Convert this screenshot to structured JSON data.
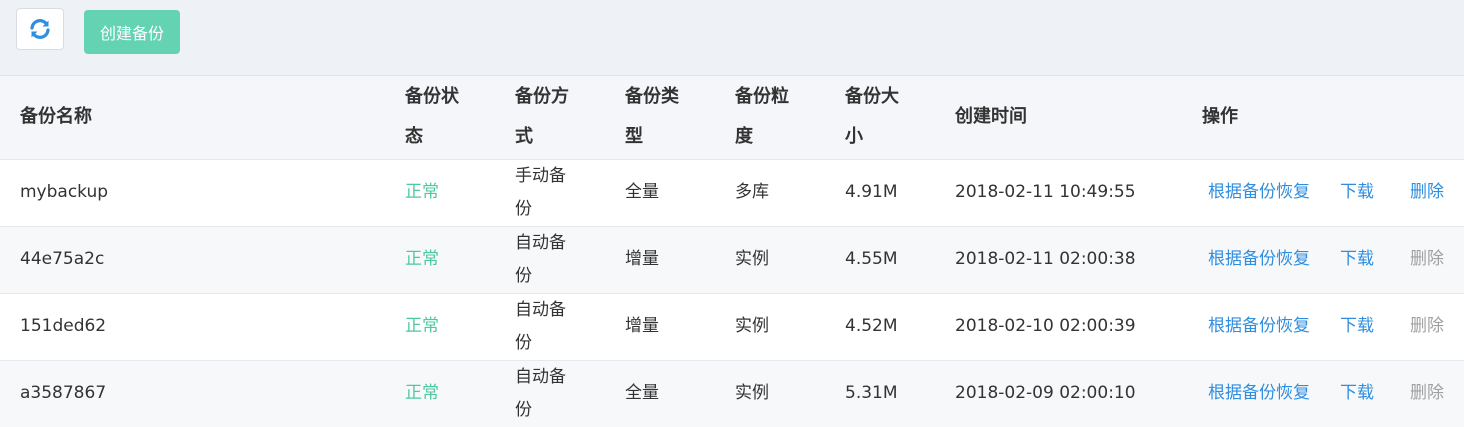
{
  "toolbar": {
    "refresh_icon": "refresh-icon",
    "create_label": "创建备份"
  },
  "table": {
    "columns": [
      "备份名称",
      "备份状态",
      "备份方式",
      "备份类型",
      "备份粒度",
      "备份大小",
      "创建时间",
      "操作"
    ],
    "rows": [
      {
        "name": "mybackup",
        "status": "正常",
        "method": "手动备份",
        "type": "全量",
        "granularity": "多库",
        "size": "4.91M",
        "created": "2018-02-11 10:49:55",
        "restore": "根据备份恢复",
        "download": "下载",
        "delete": "删除",
        "delete_enabled": true
      },
      {
        "name": "44e75a2c",
        "status": "正常",
        "method": "自动备份",
        "type": "增量",
        "granularity": "实例",
        "size": "4.55M",
        "created": "2018-02-11 02:00:38",
        "restore": "根据备份恢复",
        "download": "下载",
        "delete": "删除",
        "delete_enabled": false
      },
      {
        "name": "151ded62",
        "status": "正常",
        "method": "自动备份",
        "type": "增量",
        "granularity": "实例",
        "size": "4.52M",
        "created": "2018-02-10 02:00:39",
        "restore": "根据备份恢复",
        "download": "下载",
        "delete": "删除",
        "delete_enabled": false
      },
      {
        "name": "a3587867",
        "status": "正常",
        "method": "自动备份",
        "type": "全量",
        "granularity": "实例",
        "size": "5.31M",
        "created": "2018-02-09 02:00:10",
        "restore": "根据备份恢复",
        "download": "下载",
        "delete": "删除",
        "delete_enabled": false
      }
    ]
  },
  "colors": {
    "accent_green": "#63d3b1",
    "status_ok": "#4fc8a0",
    "link_blue": "#2f8ee0",
    "disabled_gray": "#a0a0a0"
  }
}
